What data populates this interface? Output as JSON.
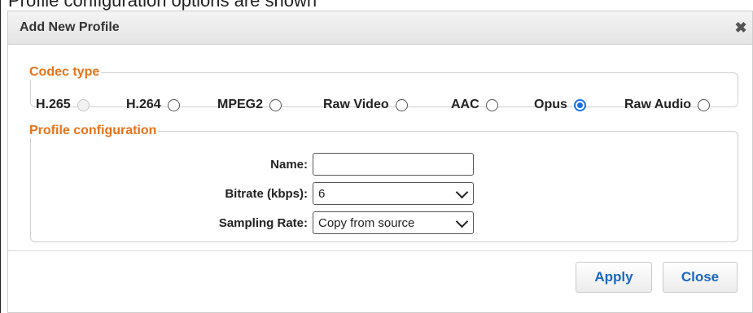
{
  "background_text": "Profile configuration options are shown",
  "dialog": {
    "title": "Add New Profile",
    "close_icon": "close-icon"
  },
  "codec": {
    "legend": "Codec type",
    "options": [
      {
        "label": "H.265",
        "state": "disabled"
      },
      {
        "label": "H.264",
        "state": "unchecked"
      },
      {
        "label": "MPEG2",
        "state": "unchecked"
      },
      {
        "label": "Raw Video",
        "state": "unchecked"
      },
      {
        "label": "AAC",
        "state": "unchecked"
      },
      {
        "label": "Opus",
        "state": "checked"
      },
      {
        "label": "Raw Audio",
        "state": "unchecked"
      }
    ]
  },
  "profile": {
    "legend": "Profile configuration",
    "name_label": "Name:",
    "name_value": "",
    "bitrate_label": "Bitrate (kbps):",
    "bitrate_value": "6",
    "sampling_label": "Sampling Rate:",
    "sampling_value": "Copy from source"
  },
  "buttons": {
    "apply": "Apply",
    "close": "Close"
  },
  "colors": {
    "legend": "#e8731a",
    "button_text": "#1a66c2",
    "radio_checked": "#1a6fe8"
  }
}
